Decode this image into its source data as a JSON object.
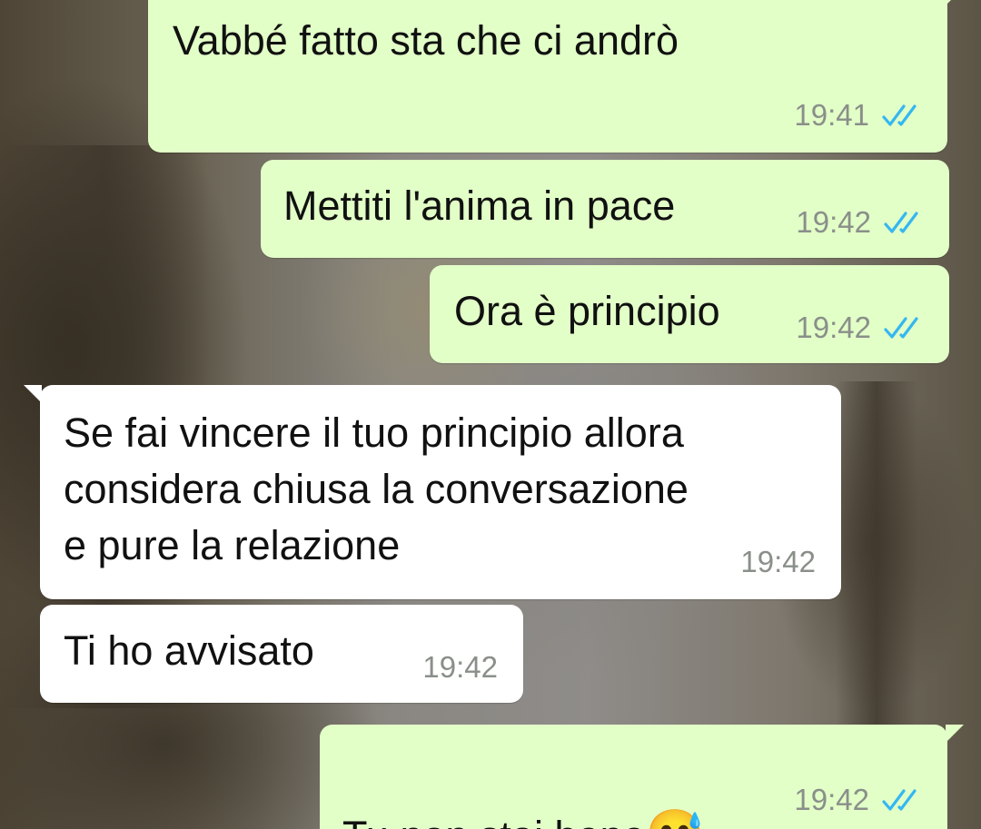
{
  "chat": {
    "messages": [
      {
        "id": "m1",
        "direction": "outgoing",
        "text": "Vabbé fatto sta che ci andrò",
        "time": "19:41",
        "status": "read"
      },
      {
        "id": "m2",
        "direction": "outgoing",
        "text": "Mettiti l'anima in pace",
        "time": "19:42",
        "status": "read"
      },
      {
        "id": "m3",
        "direction": "outgoing",
        "text": "Ora è principio",
        "time": "19:42",
        "status": "read"
      },
      {
        "id": "m4",
        "direction": "incoming",
        "text": "Se fai vincere il tuo principio allora\nconsidera chiusa la conversazione\ne pure la relazione",
        "time": "19:42"
      },
      {
        "id": "m5",
        "direction": "incoming",
        "text": "Ti ho avvisato",
        "time": "19:42"
      },
      {
        "id": "m6",
        "direction": "outgoing",
        "text": "Tu non stai bene",
        "emoji": "😅",
        "time": "19:42",
        "status": "read"
      }
    ]
  },
  "colors": {
    "outgoing_bubble": "#e2ffc7",
    "incoming_bubble": "#ffffff",
    "read_ticks": "#34b7f1",
    "timestamp": "#8a8f8a"
  },
  "icons": {
    "read_status": "double-check-icon",
    "emoji": "grinning-sweat-emoji-icon"
  }
}
